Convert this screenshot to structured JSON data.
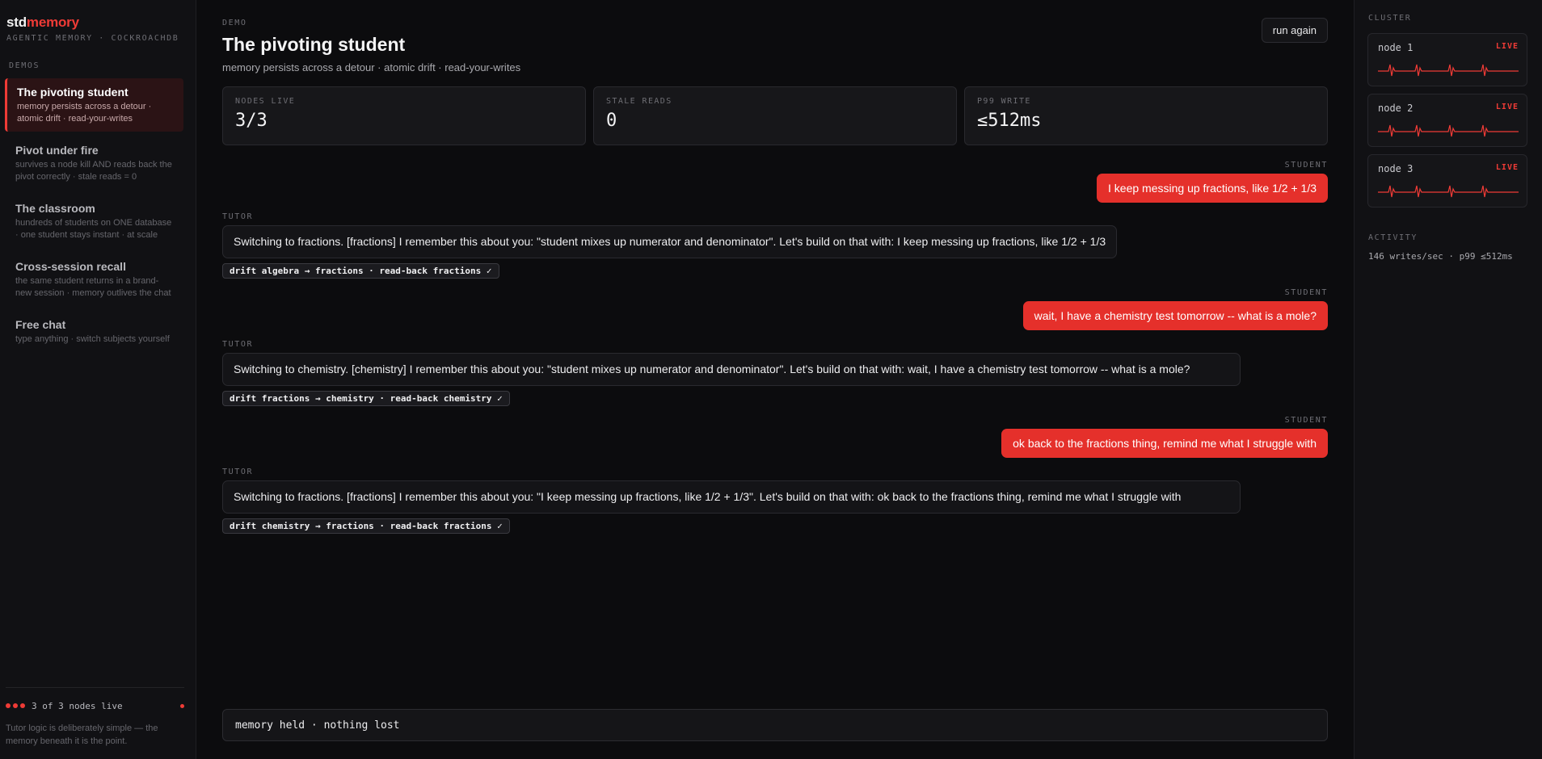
{
  "sidebar": {
    "brand_prefix": "std",
    "brand_suffix": "memory",
    "brand_sub": "AGENTIC MEMORY · COCKROACHDB",
    "section_label": "DEMOS",
    "items": [
      {
        "title": "The pivoting student",
        "desc": "memory persists across a detour · atomic drift · read-your-writes",
        "active": true
      },
      {
        "title": "Pivot under fire",
        "desc": "survives a node kill AND reads back the pivot correctly · stale reads = 0"
      },
      {
        "title": "The classroom",
        "desc": "hundreds of students on ONE database · one student stays instant · at scale"
      },
      {
        "title": "Cross-session recall",
        "desc": "the same student returns in a brand-new session · memory outlives the chat"
      },
      {
        "title": "Free chat",
        "desc": "type anything · switch subjects yourself"
      }
    ],
    "footer_status": "3 of 3 nodes live",
    "footer_note": "Tutor logic is deliberately simple — the memory beneath it is the point."
  },
  "main": {
    "eyebrow": "DEMO",
    "title": "The pivoting student",
    "subtitle": "memory persists across a detour · atomic drift · read-your-writes",
    "run_again": "run again",
    "stats": [
      {
        "label": "NODES LIVE",
        "value": "3/3"
      },
      {
        "label": "STALE READS",
        "value": "0"
      },
      {
        "label": "P99 WRITE",
        "value": "≤512ms"
      }
    ],
    "messages": [
      {
        "role": "STUDENT",
        "text": "I keep messing up fractions, like 1/2 + 1/3"
      },
      {
        "role": "TUTOR",
        "text": "Switching to fractions. [fractions] I remember this about you: \"student mixes up numerator and denominator\". Let's build on that with: I keep messing up fractions, like 1/2 + 1/3",
        "tag": "drift algebra → fractions · read-back fractions ✓"
      },
      {
        "role": "STUDENT",
        "text": "wait, I have a chemistry test tomorrow -- what is a mole?"
      },
      {
        "role": "TUTOR",
        "text": "Switching to chemistry. [chemistry] I remember this about you: \"student mixes up numerator and denominator\". Let's build on that with: wait, I have a chemistry test tomorrow -- what is a mole?",
        "tag": "drift fractions → chemistry · read-back chemistry ✓"
      },
      {
        "role": "STUDENT",
        "text": "ok back to the fractions thing, remind me what I struggle with"
      },
      {
        "role": "TUTOR",
        "text": "Switching to fractions. [fractions] I remember this about you: \"I keep messing up fractions, like 1/2 + 1/3\". Let's build on that with: ok back to the fractions thing, remind me what I struggle with",
        "tag": "drift chemistry → fractions · read-back fractions ✓"
      }
    ],
    "status_bar": "memory held · nothing lost"
  },
  "cluster": {
    "label": "CLUSTER",
    "nodes": [
      {
        "name": "node 1",
        "status": "LIVE"
      },
      {
        "name": "node 2",
        "status": "LIVE"
      },
      {
        "name": "node 3",
        "status": "LIVE"
      }
    ],
    "activity_label": "ACTIVITY",
    "activity_text": "146 writes/sec · p99 ≤512ms"
  },
  "colors": {
    "accent": "#ef3b36",
    "background": "#0c0c0e",
    "panel": "#111114"
  }
}
